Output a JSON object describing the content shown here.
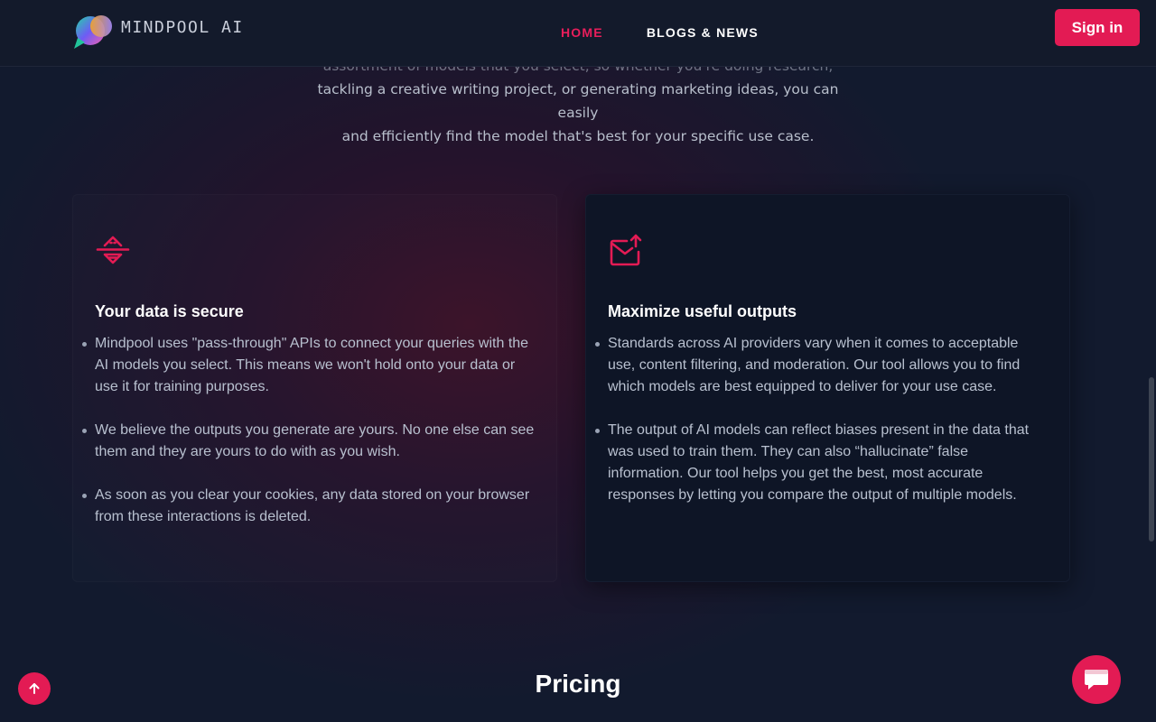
{
  "brand": {
    "name": "MINDPOOL AI"
  },
  "nav": {
    "items": [
      "HOME",
      "BLOGS & NEWS"
    ],
    "active": 0
  },
  "header": {
    "signin_label": "Sign in"
  },
  "intro": {
    "lines": [
      "assortment of models that you select, so whether you're doing research,",
      "tackling a creative writing project, or generating marketing ideas, you can easily",
      "and efficiently find the model that's best for your specific use case."
    ]
  },
  "cards": [
    {
      "icon": "filter-split-icon",
      "title": "Your data is secure",
      "bullets": [
        "Mindpool uses \"pass-through\" APIs to connect your queries with the AI models you select. This means we won't hold onto your data or use it for training purposes.",
        "We believe the outputs you generate are yours. No one else can see them and they are yours to do with as you wish.",
        "As soon as you clear your cookies, any data stored on your browser from these interactions is deleted."
      ]
    },
    {
      "icon": "mail-upload-icon",
      "title": "Maximize useful outputs",
      "bullets": [
        "Standards across AI providers vary when it comes to acceptable use, content filtering, and moderation. Our tool allows you to find which models are best equipped to deliver for your use case.",
        "The output of AI models can reflect biases present in the data that was used to train them. They can also “hallucinate” false information. Our tool helps you get the best, most accurate responses by letting you compare the output of multiple models."
      ]
    }
  ],
  "pricing": {
    "title": "Pricing"
  },
  "colors": {
    "accent": "#e31b54",
    "card_bg": "#0e1526",
    "header_bg": "#131a2b"
  }
}
